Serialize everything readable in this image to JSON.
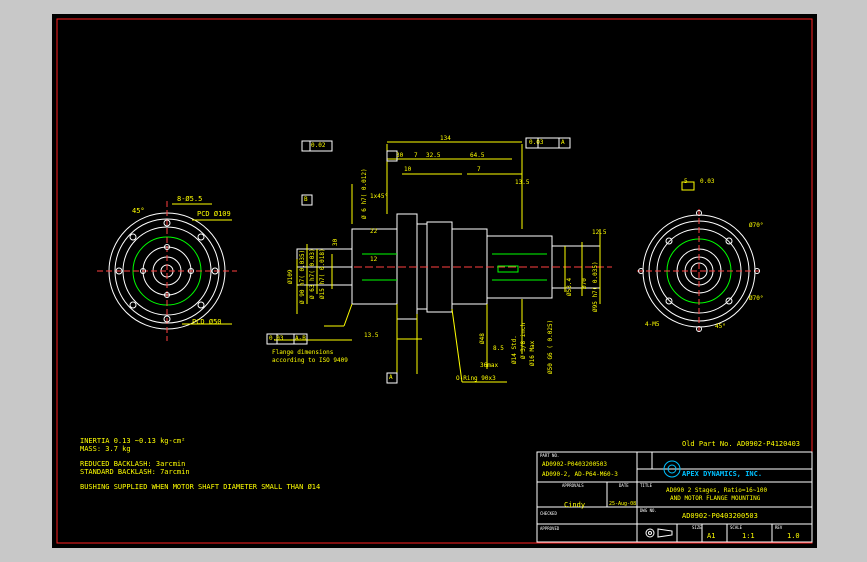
{
  "notes": {
    "inertia": "INERTIA   0.13 ~0.13 kg-cm²",
    "mass": "MASS: 3.7 kg",
    "reduced_backlash": "REDUCED BACKLASH: 3arcmin",
    "standard_backlash": "STANDARD BACKLASH: 7arcmin",
    "bushing": "BUSHING SUPPLIED WHEN MOTOR SHAFT DIAMETER SMALL THAN Ø14"
  },
  "old_part_no": "Old Part No. AD0902-P4120403",
  "title_block": {
    "part_no_label": "PART NO.",
    "part_no_1": "AD0902-P0403200503",
    "part_no_2": "AD090-2, AD-P64-M60-3",
    "company": "APEX DYNAMICS, INC.",
    "approval_label": "APPROVALS",
    "date_label": "DATE",
    "title_label": "TITLE",
    "title_1": "AD090 2 Stages, Ratio=16~100",
    "title_2": "AND MOTOR FLANGE MOUNTING",
    "drawn_by": "Cindy",
    "date": "25-Aug-08",
    "checked_label": "CHECKED",
    "dwg_no_label": "DWG NO.",
    "dwg_no": "AD0902-P0403200503",
    "approved_label": "APPROVED",
    "size_label": "SIZE",
    "size": "A1",
    "scale_label": "SCALE",
    "scale": "1:1",
    "rev_label": "REV",
    "rev": "1.0"
  },
  "left_view": {
    "bolt_label": "8-Ø5.5",
    "angle": "45°",
    "pcd_outer": "PCD Ø109",
    "pcd_inner": "PCD Ø50"
  },
  "right_view": {
    "key_label": "5",
    "key_dim": "0.03",
    "angle1": "Ø70°",
    "angle2": "Ø70°",
    "angle3": "45°",
    "holes": "4-M5"
  },
  "side_view": {
    "dim_134": "134",
    "dim_flat": "0.03",
    "dim_datum_a": "A",
    "dim_perp": "0.02",
    "dim_datum_b": "B",
    "dim_30": "30",
    "dim_7": "7",
    "dim_32_5": "32.5",
    "dim_64_5": "64.5",
    "dim_10": "10",
    "dim_13_5": "13.5",
    "dim_7b": "7",
    "dim_1x45": "1x45°",
    "dim_6h7": "Ø 6 h7(  0.012)",
    "dim_22": "22",
    "dim_12": "12",
    "dim_109": "Ø109",
    "dim_90": "Ø 90 h7(  0.035)",
    "dim_63": "Ø 63 h7(  0.03)",
    "dim_15": "Ø15 h7( 0.018)",
    "dim_13_5b": "13.5",
    "dim_30b": "30",
    "dim_tol": "0.03",
    "dim_ab": "A-B",
    "dim_53_4": "Ø53.4",
    "dim_70": "Ø70",
    "dim_95": "Ø95 h7(  0.035)",
    "dim_125": "12.5",
    "dim_48": "Ø48",
    "dim_14std": "Ø14 Std.",
    "dim_85": "8.5",
    "dim_36": "36max",
    "dim_50": "Ø50 G6 (  0.025)",
    "dim_0375": "Ø 3/8 inch",
    "dim_16": "Ø16 Max",
    "flange_note_1": "Flange dimensions",
    "flange_note_2": "according to ISO 9409",
    "datum_c": "A",
    "oring": "O-Ring 90x3"
  }
}
